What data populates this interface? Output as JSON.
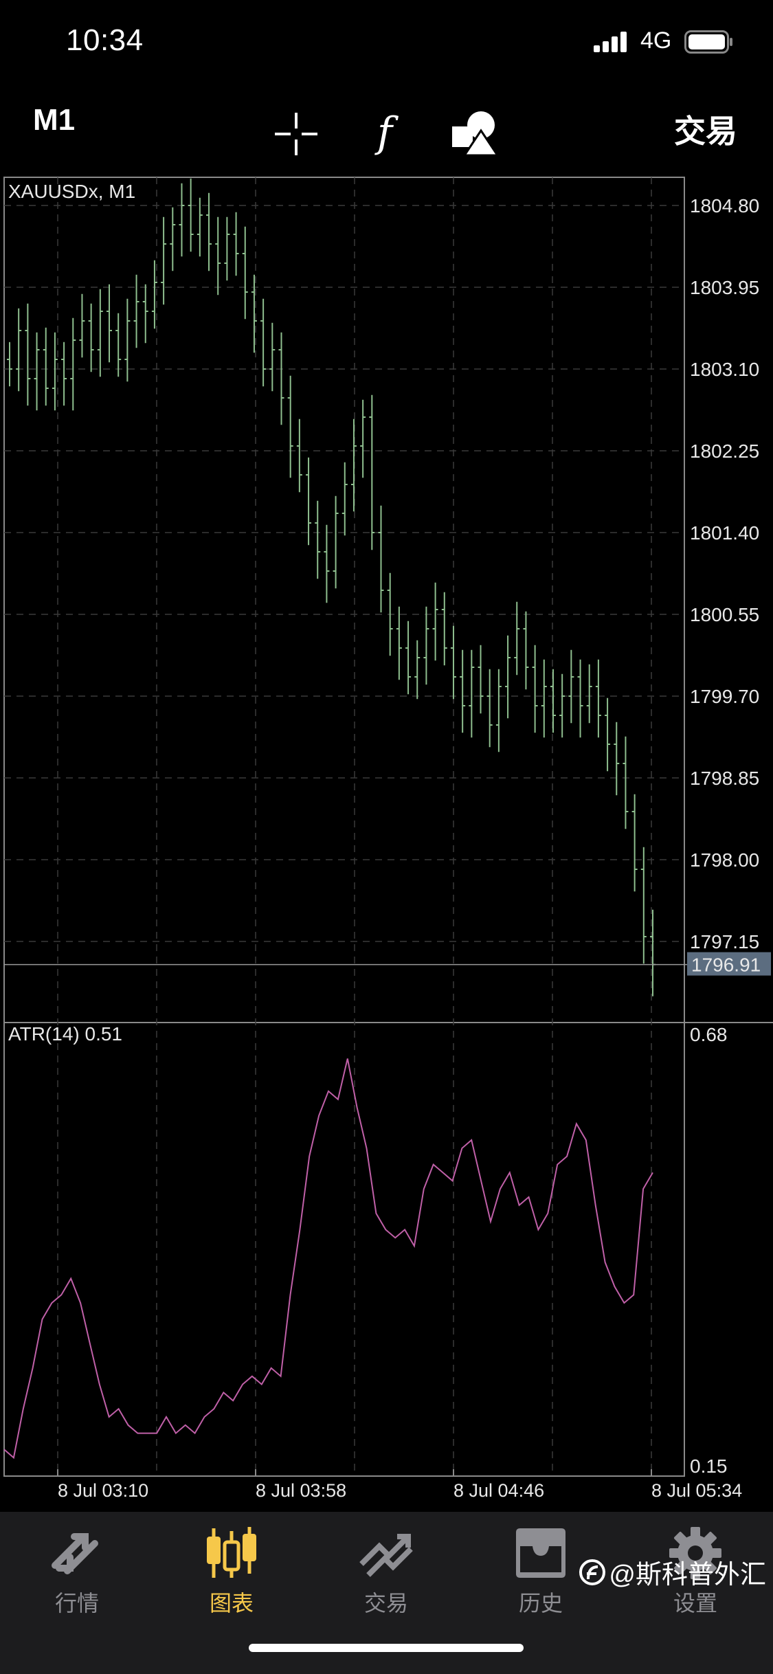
{
  "status_bar": {
    "time": "10:34",
    "network": "4G"
  },
  "toolbar": {
    "timeframe": "M1",
    "trade_label": "交易",
    "fx_symbol": "f",
    "icons": [
      "crosshair-icon",
      "function-icon",
      "objects-icon"
    ]
  },
  "chart": {
    "symbol_label": "XAUUSDx, M1",
    "price_ticks": [
      "1804.80",
      "1803.95",
      "1803.10",
      "1802.25",
      "1801.40",
      "1800.55",
      "1799.70",
      "1798.85",
      "1798.00",
      "1797.15"
    ],
    "current_price": "1796.91",
    "time_ticks": [
      "8 Jul 03:10",
      "8 Jul 03:58",
      "8 Jul 04:46",
      "8 Jul 05:34"
    ],
    "atr_label": "ATR(14) 0.51",
    "atr_ticks": [
      "0.68",
      "0.15"
    ],
    "colors": {
      "candles": "#8fbf8f",
      "atr_line": "#c060a8",
      "grid": "#3a3a3a",
      "price_highlight": "#5c6d80"
    }
  },
  "chart_data": [
    {
      "type": "line",
      "title": "XAUUSDx, M1",
      "description": "Price bars (approximate close)",
      "ylim": [
        1796.3,
        1805.2
      ],
      "x_ticks": [
        "8 Jul 03:10",
        "8 Jul 03:58",
        "8 Jul 04:46",
        "8 Jul 05:34"
      ],
      "series": [
        {
          "values": [
            1803.1,
            1803.5,
            1803.0,
            1803.3,
            1802.9,
            1803.2,
            1803.0,
            1803.4,
            1803.6,
            1803.3,
            1803.7,
            1803.5,
            1803.2,
            1803.6,
            1803.8,
            1803.7,
            1804.0,
            1804.4,
            1804.6,
            1804.8,
            1804.5,
            1804.7,
            1804.4,
            1804.2,
            1804.5,
            1804.3,
            1803.9,
            1803.6,
            1803.1,
            1803.3,
            1802.8,
            1802.3,
            1802.0,
            1801.5,
            1801.2,
            1801.0,
            1801.6,
            1801.9,
            1802.3,
            1802.6,
            1801.4,
            1800.8,
            1800.4,
            1800.2,
            1799.9,
            1800.1,
            1800.4,
            1800.6,
            1800.2,
            1799.9,
            1799.6,
            1800.0,
            1799.7,
            1799.4,
            1799.8,
            1800.1,
            1800.4,
            1800.0,
            1799.6,
            1799.8,
            1799.5,
            1799.7,
            1799.9,
            1799.6,
            1799.8,
            1799.5,
            1799.2,
            1799.0,
            1798.5,
            1797.9,
            1797.2,
            1796.91
          ]
        }
      ],
      "ytick_labels": [
        "1804.80",
        "1803.95",
        "1803.10",
        "1802.25",
        "1801.40",
        "1800.55",
        "1799.70",
        "1798.85",
        "1798.00",
        "1797.15"
      ]
    },
    {
      "type": "line",
      "title": "ATR(14) 0.51",
      "ylim": [
        0.15,
        0.68
      ],
      "x_ticks": [
        "8 Jul 03:10",
        "8 Jul 03:58",
        "8 Jul 04:46",
        "8 Jul 05:34"
      ],
      "series": [
        {
          "name": "ATR(14)",
          "values": [
            0.17,
            0.16,
            0.22,
            0.27,
            0.33,
            0.35,
            0.36,
            0.38,
            0.35,
            0.3,
            0.25,
            0.21,
            0.22,
            0.2,
            0.19,
            0.19,
            0.19,
            0.21,
            0.19,
            0.2,
            0.19,
            0.21,
            0.22,
            0.24,
            0.23,
            0.25,
            0.26,
            0.25,
            0.27,
            0.26,
            0.36,
            0.44,
            0.53,
            0.58,
            0.61,
            0.6,
            0.65,
            0.59,
            0.54,
            0.46,
            0.44,
            0.43,
            0.44,
            0.42,
            0.49,
            0.52,
            0.51,
            0.5,
            0.54,
            0.55,
            0.5,
            0.45,
            0.49,
            0.51,
            0.47,
            0.48,
            0.44,
            0.46,
            0.52,
            0.53,
            0.57,
            0.55,
            0.47,
            0.4,
            0.37,
            0.35,
            0.36,
            0.49,
            0.51
          ]
        }
      ]
    }
  ],
  "tabbar": {
    "tabs": [
      {
        "label": "行情",
        "icon": "quotes-icon"
      },
      {
        "label": "图表",
        "icon": "chart-candles-icon"
      },
      {
        "label": "交易",
        "icon": "trade-icon"
      },
      {
        "label": "历史",
        "icon": "history-icon"
      },
      {
        "label": "设置",
        "icon": "settings-icon"
      }
    ]
  },
  "watermark": "@斯科普外汇"
}
